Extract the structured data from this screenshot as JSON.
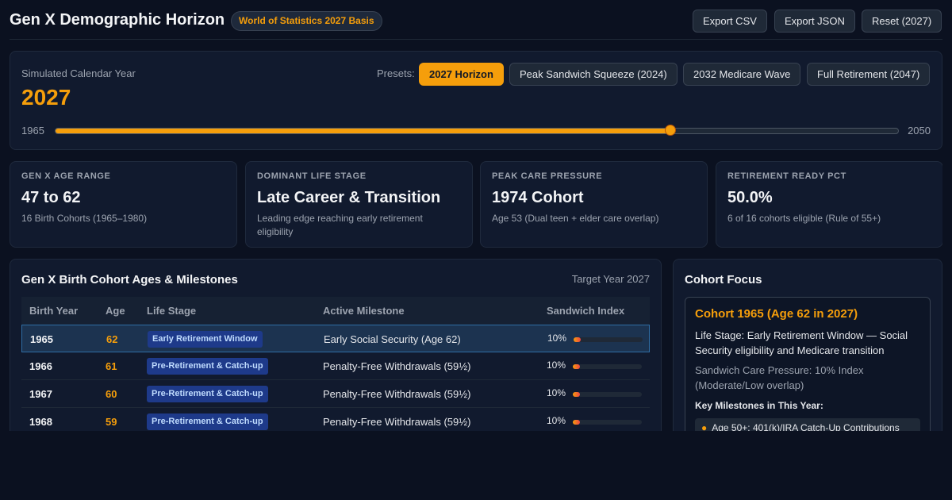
{
  "header": {
    "title": "Gen X Demographic Horizon",
    "badge": "World of Statistics 2027 Basis",
    "buttons": {
      "export_csv": "Export CSV",
      "export_json": "Export JSON",
      "reset": "Reset (2027)"
    }
  },
  "year_control": {
    "label": "Simulated Calendar Year",
    "value": "2027",
    "presets_label": "Presets:",
    "presets": [
      "2027 Horizon",
      "Peak Sandwich Squeeze (2024)",
      "2032 Medicare Wave",
      "Full Retirement (2047)"
    ],
    "active_preset": 0,
    "slider": {
      "min": "1965",
      "max": "2050",
      "current": 2027
    }
  },
  "stats": [
    {
      "label": "GEN X AGE RANGE",
      "value": "47 to 62",
      "sub": "16 Birth Cohorts (1965–1980)"
    },
    {
      "label": "DOMINANT LIFE STAGE",
      "value": "Late Career & Transition",
      "sub": "Leading edge reaching early retirement eligibility"
    },
    {
      "label": "PEAK CARE PRESSURE",
      "value": "1974 Cohort",
      "sub": "Age 53 (Dual teen + elder care overlap)"
    },
    {
      "label": "RETIREMENT READY PCT",
      "value": "50.0%",
      "sub": "6 of 16 cohorts eligible (Rule of 55+)"
    }
  ],
  "table": {
    "title": "Gen X Birth Cohort Ages & Milestones",
    "target": "Target Year 2027",
    "headers": {
      "year": "Birth Year",
      "age": "Age",
      "stage": "Life Stage",
      "milestone": "Active Milestone",
      "sandwich": "Sandwich Index"
    },
    "rows": [
      {
        "year": "1965",
        "age": "62",
        "stage": "Early Retirement Window",
        "milestone": "Early Social Security (Age 62)",
        "sandwich": "10%",
        "sandwich_value": 0.1
      },
      {
        "year": "1966",
        "age": "61",
        "stage": "Pre-Retirement & Catch-up",
        "milestone": "Penalty-Free Withdrawals (59½)",
        "sandwich": "10%",
        "sandwich_value": 0.1
      },
      {
        "year": "1967",
        "age": "60",
        "stage": "Pre-Retirement & Catch-up",
        "milestone": "Penalty-Free Withdrawals (59½)",
        "sandwich": "10%",
        "sandwich_value": 0.1
      },
      {
        "year": "1968",
        "age": "59",
        "stage": "Pre-Retirement & Catch-up",
        "milestone": "Penalty-Free Withdrawals (59½)",
        "sandwich": "10%",
        "sandwich_value": 0.1
      }
    ],
    "selected_row": 0
  },
  "focus": {
    "title": "Cohort Focus",
    "heading": "Cohort 1965 (Age 62 in 2027)",
    "stage": "Life Stage: Early Retirement Window — Social Security eligibility and Medicare transition",
    "pressure": "Sandwich Care Pressure: 10% Index (Moderate/Low overlap)",
    "key_label": "Key Milestones in This Year:",
    "items": [
      "Age 50+: 401(k)/IRA Catch-Up Contributions"
    ]
  },
  "colors": {
    "accent": "#f59e0b",
    "background": "#0b1120",
    "panel": "#111a2e",
    "badge": "#1e3a8a"
  }
}
